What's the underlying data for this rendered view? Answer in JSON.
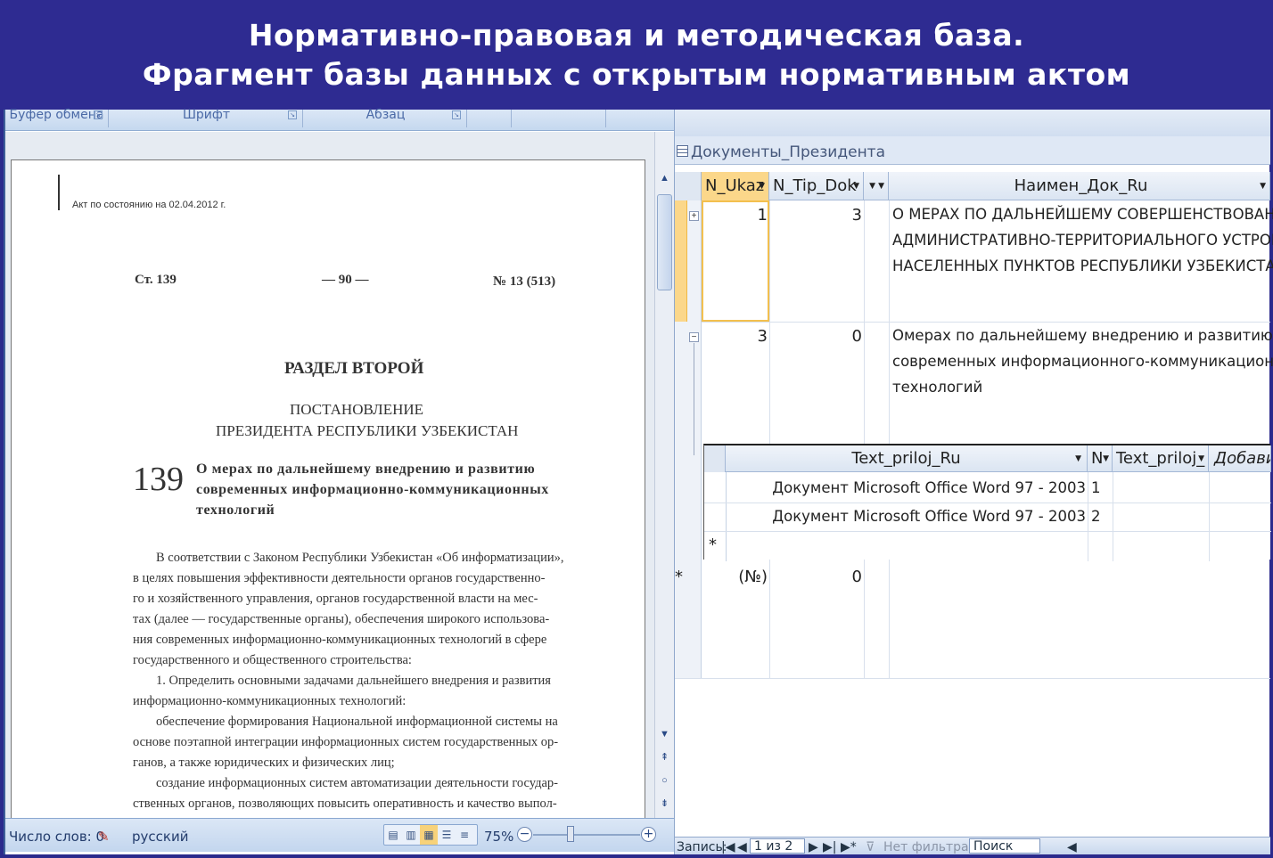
{
  "banner": {
    "line1": "Нормативно-правовая и методическая база.",
    "line2": "Фрагмент базы данных с открытым нормативным актом"
  },
  "word": {
    "ribbon_groups": [
      {
        "label": "Буфер обмена"
      },
      {
        "label": "Шрифт"
      },
      {
        "label": "Абзац"
      }
    ],
    "page": {
      "act_date": "Акт по состоянию на 02.04.2012 г.",
      "header_left": "Ст. 139",
      "header_center": "— 90 —",
      "header_right": "№ 13 (513)",
      "section": "РАЗДЕЛ ВТОРОЙ",
      "doc_type": "ПОСТАНОВЛЕНИЕ",
      "issuer": "ПРЕЗИДЕНТА РЕСПУБЛИКИ УЗБЕКИСТАН",
      "number": "139",
      "title_lines": [
        "О мерах по дальнейшему внедрению и развитию",
        "современных информационно-коммуникационных",
        "технологий"
      ],
      "body_lines": [
        "В соответствии с Законом Республики Узбекистан «Об информатизации»,",
        "в целях повышения эффективности деятельности органов государственно-",
        "го и хозяйственного управления, органов государственной власти на мес-",
        "тах (далее — государственные органы), обеспечения широкого использова-",
        "ния современных информационно-коммуникационных технологий в сфере",
        "государственного и общественного строительства:",
        "1. Определить основными задачами дальнейшего внедрения и развития",
        "информационно-коммуникационных технологий:",
        "обеспечение формирования Национальной информационной системы на",
        "основе поэтапной интеграции информационных систем государственных ор-",
        "ганов, а также юридических и физических лиц;",
        "создание информационных систем автоматизации деятельности государ-",
        "ственных органов, позволяющих повысить оперативность и качество выпол-"
      ]
    },
    "status": {
      "word_count": "Число слов: 0",
      "language": "русский",
      "zoom": "75%"
    }
  },
  "access": {
    "table_name": "Документы_Президента",
    "columns": [
      {
        "label": "N_Ukaz"
      },
      {
        "label": "N_Tip_Dok"
      },
      {
        "label": ""
      },
      {
        "label": "Наимен_Док_Ru"
      }
    ],
    "rows": [
      {
        "expander": "+",
        "n_ukaz": "1",
        "n_tip": "3",
        "name_lines": [
          "О МЕРАХ ПО ДАЛЬНЕЙШЕМУ СОВЕРШЕНСТВОВАНИЮ",
          "АДМИНИСТРАТИВНО-ТЕРРИТОРИАЛЬНОГО УСТРОЙСТВА",
          "НАСЕЛЕННЫХ ПУНКТОВ  РЕСПУБЛИКИ УЗБЕКИСТАН"
        ]
      },
      {
        "expander": "−",
        "n_ukaz": "3",
        "n_tip": "0",
        "name_lines": [
          "Омерах по дальнейшему внедрению и развитию",
          "современных информационного-коммуникационных",
          "технологий"
        ]
      }
    ],
    "subtable": {
      "columns": [
        {
          "label": "Text_priloj_Ru"
        },
        {
          "label": "N"
        },
        {
          "label": "Text_priloj_"
        },
        {
          "label": "Добавить"
        }
      ],
      "rows": [
        {
          "text": "Документ Microsoft Office Word 97 - 2003",
          "n": "1"
        },
        {
          "text": "Документ Microsoft Office Word 97 - 2003",
          "n": "2"
        }
      ],
      "new_marker": "*"
    },
    "new_row": {
      "marker": "*",
      "n_ukaz": "(№)",
      "n_tip": "0"
    },
    "nav": {
      "record_label": "Запись:",
      "record_value": "1 из 2",
      "filter_label": "Нет фильтра",
      "search_label": "Поиск"
    }
  }
}
